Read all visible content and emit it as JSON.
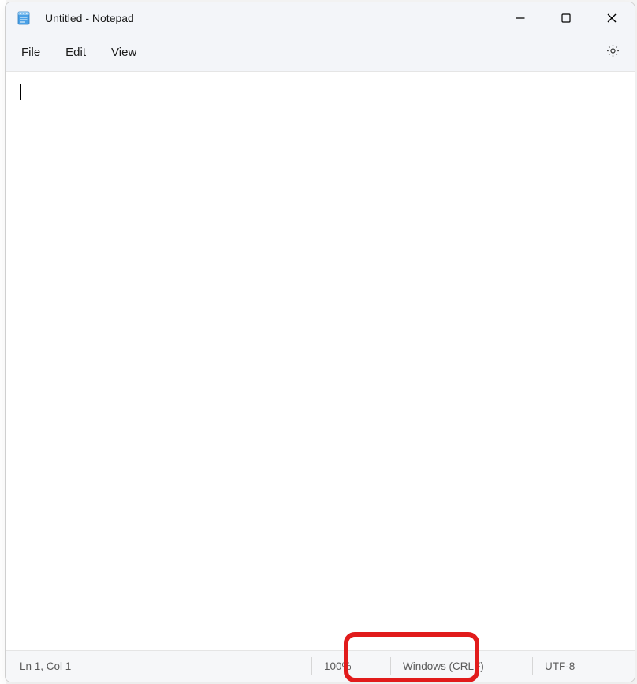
{
  "title": "Untitled - Notepad",
  "menu": {
    "file": "File",
    "edit": "Edit",
    "view": "View"
  },
  "editor": {
    "content": ""
  },
  "status": {
    "position": "Ln 1, Col 1",
    "zoom": "100%",
    "line_ending": "Windows (CRLF)",
    "encoding": "UTF-8"
  }
}
